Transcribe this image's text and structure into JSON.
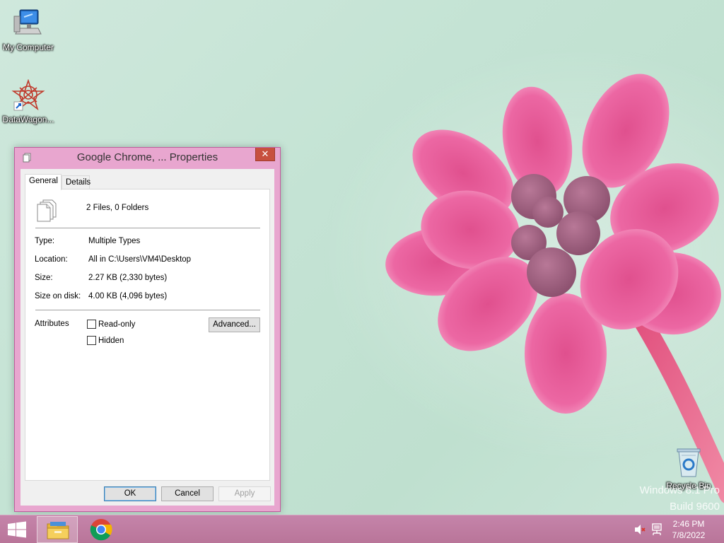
{
  "desktop": {
    "icons": [
      {
        "label": "My Computer",
        "icon": "computer-icon"
      },
      {
        "label": "DataWagon...",
        "icon": "datawagon-icon"
      },
      {
        "label": "Recycle Bin",
        "icon": "recycle-bin-icon"
      }
    ],
    "watermark": {
      "line1": "Windows 8.1 Pro",
      "line2": "Build 9600"
    }
  },
  "dialog": {
    "title": "Google Chrome, ... Properties",
    "close_label": "✕",
    "tabs": [
      {
        "label": "General",
        "active": true
      },
      {
        "label": "Details",
        "active": false
      }
    ],
    "summary": "2 Files, 0 Folders",
    "fields": [
      {
        "label": "Type:",
        "value": "Multiple Types"
      },
      {
        "label": "Location:",
        "value": "All in C:\\Users\\VM4\\Desktop"
      },
      {
        "label": "Size:",
        "value": "2.27 KB (2,330 bytes)"
      },
      {
        "label": "Size on disk:",
        "value": "4.00 KB (4,096 bytes)"
      }
    ],
    "attributes": {
      "label": "Attributes",
      "read_only": {
        "label": "Read-only",
        "checked": false
      },
      "hidden": {
        "label": "Hidden",
        "checked": false
      },
      "advanced_label": "Advanced..."
    },
    "buttons": {
      "ok": "OK",
      "cancel": "Cancel",
      "apply": "Apply"
    }
  },
  "taskbar": {
    "start": "start-icon",
    "apps": [
      {
        "name": "File Explorer",
        "icon": "file-explorer-icon",
        "active": true
      },
      {
        "name": "Google Chrome",
        "icon": "chrome-icon",
        "active": false
      }
    ],
    "tray": {
      "volume": "volume-muted-icon",
      "network": "network-icon",
      "time": "2:46 PM",
      "date": "7/8/2022"
    }
  },
  "colors": {
    "window_frame": "#e8a6cf",
    "taskbar": "#c07fa5",
    "close_button": "#c7503e",
    "wallpaper": "#c4e3d4",
    "flower": "#e4508f"
  }
}
